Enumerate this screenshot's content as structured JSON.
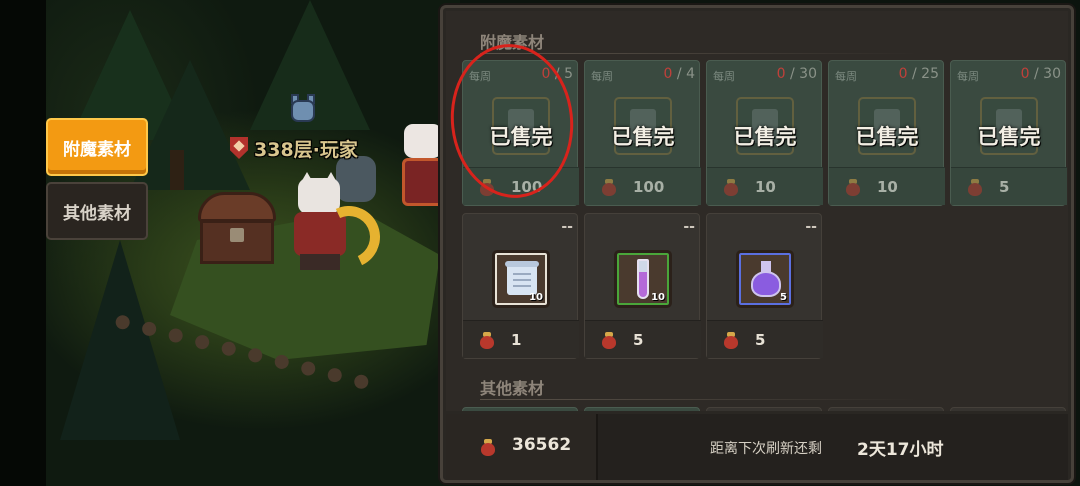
{
  "scene": {
    "player_tag": "338层·玩家"
  },
  "side_tabs": [
    {
      "label": "附魔素材",
      "active": true
    },
    {
      "label": "其他素材",
      "active": false
    }
  ],
  "sections": {
    "enchant": "附魔素材",
    "other": "其他素材"
  },
  "cards_row1": [
    {
      "limit": "每周",
      "bought": "0",
      "total": "/ 5",
      "status": "已售完",
      "price": "100"
    },
    {
      "limit": "每周",
      "bought": "0",
      "total": "/ 4",
      "status": "已售完",
      "price": "100"
    },
    {
      "limit": "每周",
      "bought": "0",
      "total": "/ 30",
      "status": "已售完",
      "price": "10"
    },
    {
      "limit": "每周",
      "bought": "0",
      "total": "/ 25",
      "status": "已售完",
      "price": "10"
    },
    {
      "limit": "每周",
      "bought": "0",
      "total": "/ 30",
      "status": "已售完",
      "price": "5"
    }
  ],
  "cards_row2": [
    {
      "limit": "--",
      "item": "scroll-icon",
      "qty": "10",
      "price": "1",
      "frame": "#e8e2d6"
    },
    {
      "limit": "--",
      "item": "test-tube-icon",
      "qty": "10",
      "price": "5",
      "frame": "#4aa63a"
    },
    {
      "limit": "--",
      "item": "potion-flask-icon",
      "qty": "5",
      "price": "5",
      "frame": "#5b6fe0"
    }
  ],
  "footer": {
    "currency_amount": "36562",
    "refresh_label": "距离下次刷新还剩",
    "refresh_time": "2天17小时"
  },
  "colors": {
    "accent_tab": "#f39a12",
    "annotation": "#d8231c",
    "sold_card": "#3a4a40",
    "limit_zero": "#c0403a"
  }
}
